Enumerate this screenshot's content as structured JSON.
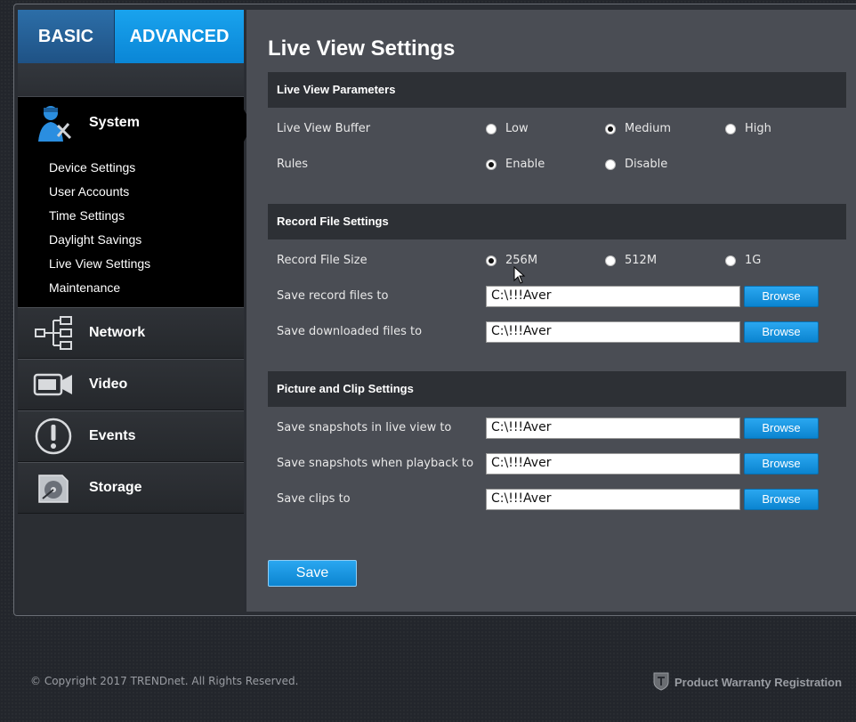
{
  "mode_tabs": {
    "basic": "BASIC",
    "advanced": "ADVANCED"
  },
  "sidebar": {
    "system": {
      "label": "System",
      "icon": "technician-icon",
      "items": [
        "Device Settings",
        "User Accounts",
        "Time Settings",
        "Daylight Savings",
        "Live View Settings",
        "Maintenance"
      ]
    },
    "network": {
      "label": "Network",
      "icon": "network-tree-icon"
    },
    "video": {
      "label": "Video",
      "icon": "camera-icon"
    },
    "events": {
      "label": "Events",
      "icon": "alert-icon"
    },
    "storage": {
      "label": "Storage",
      "icon": "hard-drive-icon"
    }
  },
  "main": {
    "title": "Live View Settings",
    "live_view_parameters": {
      "header": "Live View Parameters",
      "buffer": {
        "label": "Live View Buffer",
        "options": [
          "Low",
          "Medium",
          "High"
        ],
        "selected": "Medium"
      },
      "rules": {
        "label": "Rules",
        "options": [
          "Enable",
          "Disable"
        ],
        "selected": "Enable"
      }
    },
    "record_file_settings": {
      "header": "Record File Settings",
      "file_size": {
        "label": "Record File Size",
        "options": [
          "256M",
          "512M",
          "1G"
        ],
        "selected": "256M"
      },
      "save_record": {
        "label": "Save record files to",
        "value": "C:\\!!!Aver"
      },
      "save_downloaded": {
        "label": "Save downloaded files to",
        "value": "C:\\!!!Aver"
      }
    },
    "picture_clip_settings": {
      "header": "Picture and Clip Settings",
      "snapshots_live": {
        "label": "Save snapshots in live view to",
        "value": "C:\\!!!Aver"
      },
      "snapshots_playback": {
        "label": "Save snapshots when playback to",
        "value": "C:\\!!!Aver"
      },
      "clips": {
        "label": "Save clips to",
        "value": "C:\\!!!Aver"
      }
    },
    "browse_label": "Browse",
    "save_label": "Save"
  },
  "footer": {
    "copyright": "© Copyright 2017 TRENDnet. All Rights Reserved.",
    "warranty": "Product Warranty Registration"
  },
  "colors": {
    "accent": "#0b84d0",
    "panel": "#4a4d54",
    "section": "#2d3035"
  }
}
